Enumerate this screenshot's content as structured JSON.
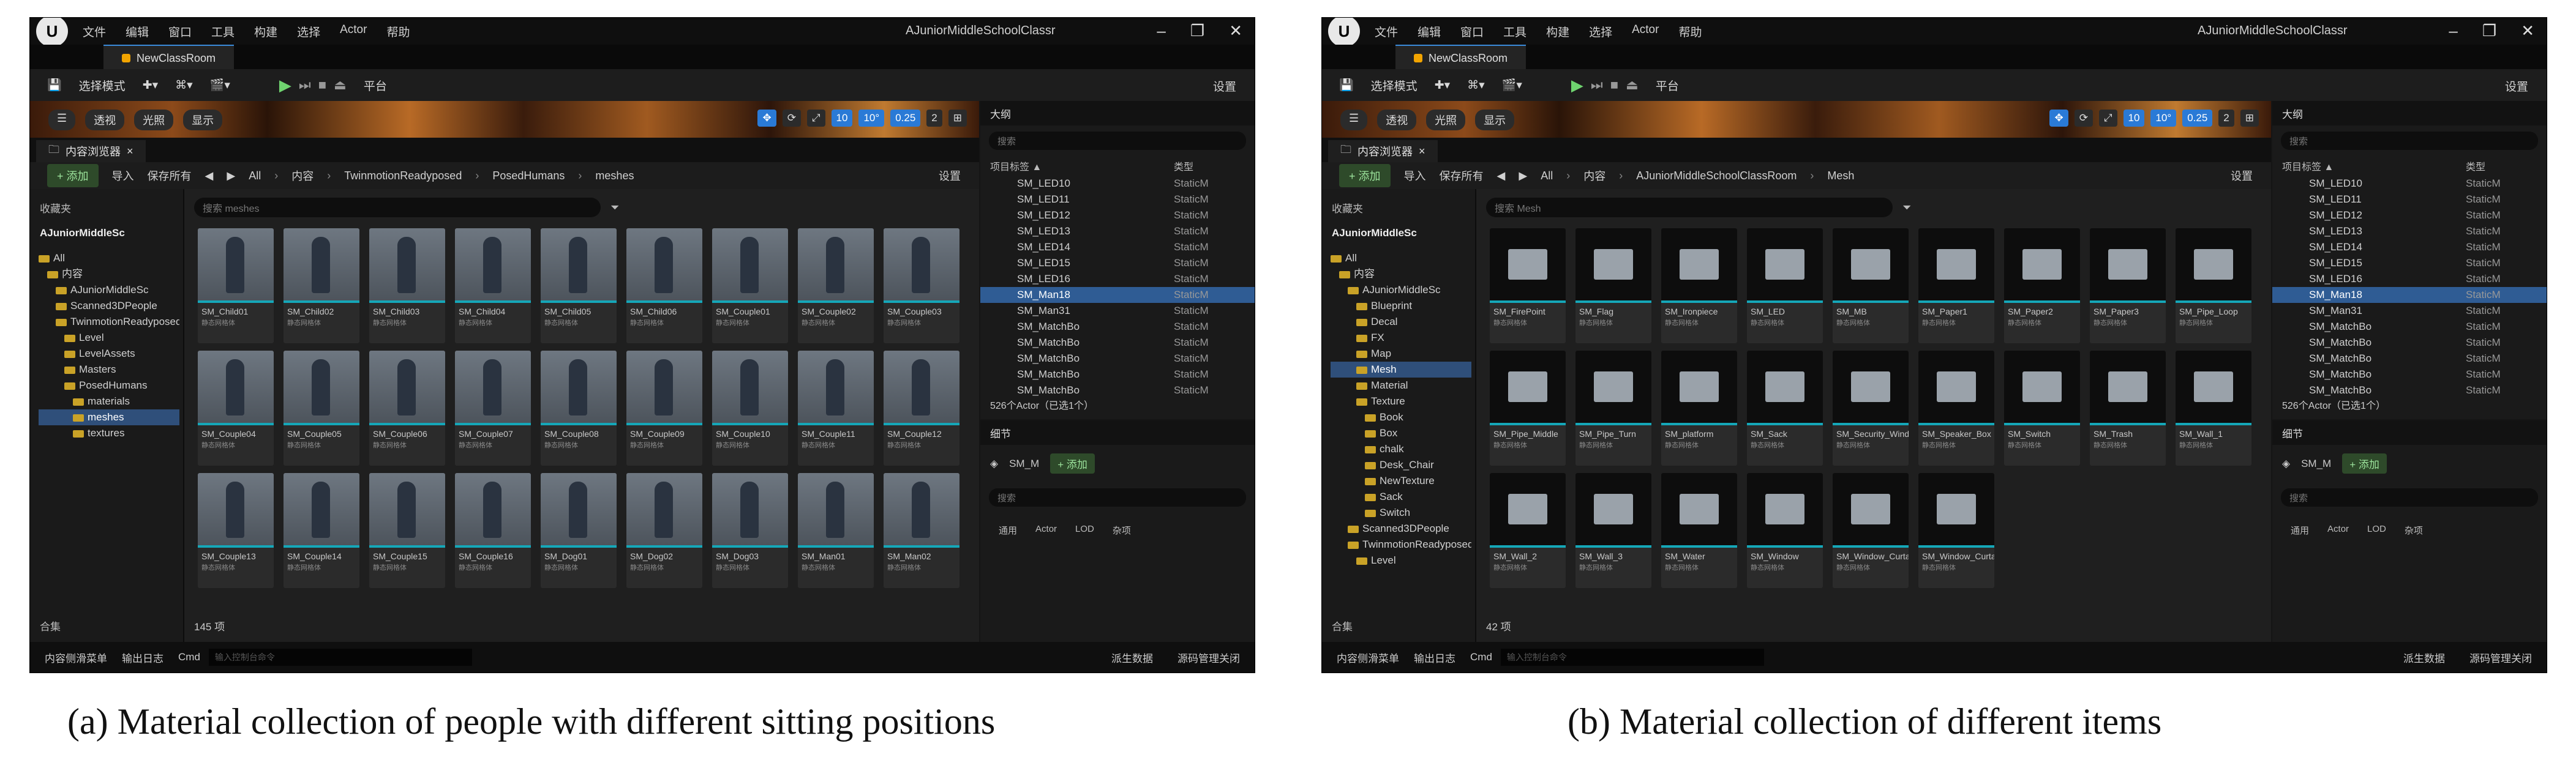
{
  "menubar": {
    "logo": "U",
    "items": [
      "文件",
      "编辑",
      "窗口",
      "工具",
      "构建",
      "选择",
      "Actor",
      "帮助"
    ],
    "project_title": "AJuniorMiddleSchoolClassr",
    "window_controls": [
      "–",
      "❐",
      "✕"
    ]
  },
  "tab": {
    "label": "NewClassRoom"
  },
  "toolbar": {
    "save": "💾",
    "select_mode": "选择模式",
    "platform": "平台",
    "settings": "设置"
  },
  "viewport": {
    "perspective": "透视",
    "lit": "光照",
    "show": "显示",
    "grid_value": "10",
    "angle_value": "10°",
    "scale_value": "0.25",
    "camera_value": "2"
  },
  "content_browser": {
    "title": "内容浏览器",
    "add": "+ 添加",
    "import": "导入",
    "save_all": "保存所有",
    "all": "All",
    "content": "内容",
    "settings": "设置",
    "favorites": "收藏夹",
    "collections": "合集"
  },
  "outliner": {
    "title": "大纲",
    "search_placeholder": "搜索",
    "col_label": "项目标签 ▲",
    "col_type": "类型"
  },
  "details": {
    "title": "细节",
    "add": "+ 添加",
    "search_placeholder": "搜索",
    "tabs": [
      "通用",
      "Actor",
      "LOD",
      "杂项"
    ]
  },
  "statusbar": {
    "drawer": "内容侧滑菜单",
    "output_log": "输出日志",
    "cmd": "Cmd",
    "cmd_placeholder": "输入控制台命令",
    "derived_data": "派生数据",
    "source_control": "源码管理关闭"
  },
  "panel_a": {
    "caption": "(a) Material collection of people with different sitting positions",
    "project_root": "AJuniorMiddleSc",
    "breadcrumb": [
      "TwinmotionReadyposed",
      "PosedHumans",
      "meshes"
    ],
    "search_placeholder": "搜索 meshes",
    "tree": [
      {
        "label": "All",
        "indent": 0,
        "selected": false
      },
      {
        "label": "内容",
        "indent": 1,
        "selected": false
      },
      {
        "label": "AJuniorMiddleSc",
        "indent": 2,
        "selected": false
      },
      {
        "label": "Scanned3DPeople",
        "indent": 2,
        "selected": false
      },
      {
        "label": "TwinmotionReadyposed",
        "indent": 2,
        "selected": false
      },
      {
        "label": "Level",
        "indent": 3,
        "selected": false
      },
      {
        "label": "LevelAssets",
        "indent": 3,
        "selected": false
      },
      {
        "label": "Masters",
        "indent": 3,
        "selected": false
      },
      {
        "label": "PosedHumans",
        "indent": 3,
        "selected": false
      },
      {
        "label": "materials",
        "indent": 4,
        "selected": false
      },
      {
        "label": "meshes",
        "indent": 4,
        "selected": true
      },
      {
        "label": "textures",
        "indent": 4,
        "selected": false
      }
    ],
    "tiles": [
      {
        "label": "SM_Child01",
        "kind": "person"
      },
      {
        "label": "SM_Child02",
        "kind": "person"
      },
      {
        "label": "SM_Child03",
        "kind": "person"
      },
      {
        "label": "SM_Child04",
        "kind": "person"
      },
      {
        "label": "SM_Child05",
        "kind": "person"
      },
      {
        "label": "SM_Child06",
        "kind": "person"
      },
      {
        "label": "SM_Couple01",
        "kind": "person"
      },
      {
        "label": "SM_Couple02",
        "kind": "person"
      },
      {
        "label": "SM_Couple03",
        "kind": "person"
      },
      {
        "label": "SM_Couple04",
        "kind": "person"
      },
      {
        "label": "SM_Couple05",
        "kind": "person"
      },
      {
        "label": "SM_Couple06",
        "kind": "person"
      },
      {
        "label": "SM_Couple07",
        "kind": "person"
      },
      {
        "label": "SM_Couple08",
        "kind": "person"
      },
      {
        "label": "SM_Couple09",
        "kind": "person"
      },
      {
        "label": "SM_Couple10",
        "kind": "person"
      },
      {
        "label": "SM_Couple11",
        "kind": "person"
      },
      {
        "label": "SM_Couple12",
        "kind": "person"
      },
      {
        "label": "SM_Couple13",
        "kind": "person"
      },
      {
        "label": "SM_Couple14",
        "kind": "person"
      },
      {
        "label": "SM_Couple15",
        "kind": "person"
      },
      {
        "label": "SM_Couple16",
        "kind": "person"
      },
      {
        "label": "SM_Dog01",
        "kind": "person"
      },
      {
        "label": "SM_Dog02",
        "kind": "person"
      },
      {
        "label": "SM_Dog03",
        "kind": "person"
      },
      {
        "label": "SM_Man01",
        "kind": "person"
      },
      {
        "label": "SM_Man02",
        "kind": "person"
      }
    ],
    "item_count": "145 项"
  },
  "panel_b": {
    "caption": "(b) Material collection of different items",
    "project_root": "AJuniorMiddleSc",
    "breadcrumb": [
      "AJuniorMiddleSchoolClassRoom",
      "Mesh"
    ],
    "search_placeholder": "搜索 Mesh",
    "tree": [
      {
        "label": "All",
        "indent": 0,
        "selected": false
      },
      {
        "label": "内容",
        "indent": 1,
        "selected": false
      },
      {
        "label": "AJuniorMiddleSc",
        "indent": 2,
        "selected": false
      },
      {
        "label": "Blueprint",
        "indent": 3,
        "selected": false
      },
      {
        "label": "Decal",
        "indent": 3,
        "selected": false
      },
      {
        "label": "FX",
        "indent": 3,
        "selected": false
      },
      {
        "label": "Map",
        "indent": 3,
        "selected": false
      },
      {
        "label": "Mesh",
        "indent": 3,
        "selected": true
      },
      {
        "label": "Material",
        "indent": 3,
        "selected": false
      },
      {
        "label": "Texture",
        "indent": 3,
        "selected": false
      },
      {
        "label": "Book",
        "indent": 4,
        "selected": false
      },
      {
        "label": "Box",
        "indent": 4,
        "selected": false
      },
      {
        "label": "chalk",
        "indent": 4,
        "selected": false
      },
      {
        "label": "Desk_Chair",
        "indent": 4,
        "selected": false
      },
      {
        "label": "NewTexture",
        "indent": 4,
        "selected": false
      },
      {
        "label": "Sack",
        "indent": 4,
        "selected": false
      },
      {
        "label": "Switch",
        "indent": 4,
        "selected": false
      },
      {
        "label": "Scanned3DPeople",
        "indent": 2,
        "selected": false
      },
      {
        "label": "TwinmotionReadyposed",
        "indent": 2,
        "selected": false
      },
      {
        "label": "Level",
        "indent": 3,
        "selected": false
      }
    ],
    "tiles": [
      {
        "label": "SM_FirePoint",
        "kind": "item"
      },
      {
        "label": "SM_Flag",
        "kind": "item"
      },
      {
        "label": "SM_Ironpiece",
        "kind": "item"
      },
      {
        "label": "SM_LED",
        "kind": "item"
      },
      {
        "label": "SM_MB",
        "kind": "item"
      },
      {
        "label": "SM_Paper1",
        "kind": "item"
      },
      {
        "label": "SM_Paper2",
        "kind": "item"
      },
      {
        "label": "SM_Paper3",
        "kind": "item"
      },
      {
        "label": "SM_Pipe_Loop",
        "kind": "item"
      },
      {
        "label": "SM_Pipe_Middle",
        "kind": "item"
      },
      {
        "label": "SM_Pipe_Turn",
        "kind": "item"
      },
      {
        "label": "SM_platform",
        "kind": "item"
      },
      {
        "label": "SM_Sack",
        "kind": "item"
      },
      {
        "label": "SM_Security_Window",
        "kind": "item"
      },
      {
        "label": "SM_Speaker_Box",
        "kind": "item"
      },
      {
        "label": "SM_Switch",
        "kind": "item"
      },
      {
        "label": "SM_Trash",
        "kind": "item"
      },
      {
        "label": "SM_Wall_1",
        "kind": "item"
      },
      {
        "label": "SM_Wall_2",
        "kind": "item"
      },
      {
        "label": "SM_Wall_3",
        "kind": "item"
      },
      {
        "label": "SM_Water",
        "kind": "item"
      },
      {
        "label": "SM_Window",
        "kind": "item"
      },
      {
        "label": "SM_Window_Curtains",
        "kind": "item"
      },
      {
        "label": "SM_Window_Curtains_Open",
        "kind": "item"
      }
    ],
    "item_count": "42 项"
  },
  "outliner_rows": [
    {
      "name": "SM_LED10",
      "type": "StaticM",
      "selected": false
    },
    {
      "name": "SM_LED11",
      "type": "StaticM",
      "selected": false
    },
    {
      "name": "SM_LED12",
      "type": "StaticM",
      "selected": false
    },
    {
      "name": "SM_LED13",
      "type": "StaticM",
      "selected": false
    },
    {
      "name": "SM_LED14",
      "type": "StaticM",
      "selected": false
    },
    {
      "name": "SM_LED15",
      "type": "StaticM",
      "selected": false
    },
    {
      "name": "SM_LED16",
      "type": "StaticM",
      "selected": false
    },
    {
      "name": "SM_Man18",
      "type": "StaticM",
      "selected": true
    },
    {
      "name": "SM_Man31",
      "type": "StaticM",
      "selected": false
    },
    {
      "name": "SM_MatchBo",
      "type": "StaticM",
      "selected": false
    },
    {
      "name": "SM_MatchBo",
      "type": "StaticM",
      "selected": false
    },
    {
      "name": "SM_MatchBo",
      "type": "StaticM",
      "selected": false
    },
    {
      "name": "SM_MatchBo",
      "type": "StaticM",
      "selected": false
    },
    {
      "name": "SM_MatchBo",
      "type": "StaticM",
      "selected": false
    }
  ],
  "outliner_count": "526个Actor（已选1个）",
  "details_object": "SM_M",
  "colors": {
    "accent": "#2a7ad6",
    "thumb_bar": "#15a7b8",
    "folder": "#c9a227",
    "play": "#6fd36f"
  }
}
